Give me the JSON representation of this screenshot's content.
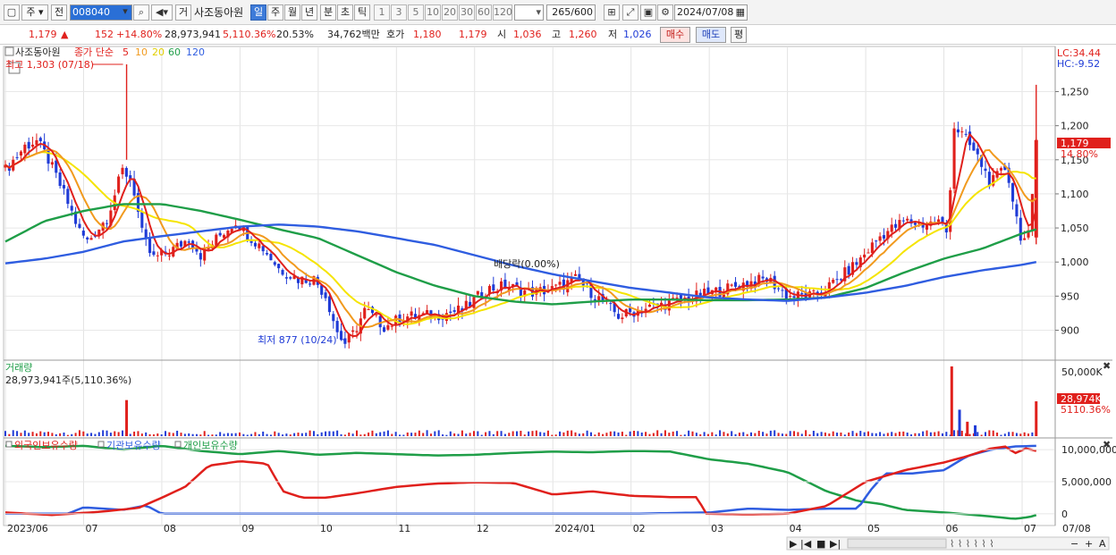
{
  "toolbar": {
    "market_label": "주",
    "prev_label": "전",
    "code": "008040",
    "gear_label": "거",
    "stock_name": "사조동아원",
    "periods": [
      "일",
      "주",
      "월",
      "년",
      "분",
      "초",
      "틱"
    ],
    "active_period": "일",
    "period_numbers": [
      "1",
      "3",
      "5",
      "10",
      "20",
      "30",
      "60",
      "120"
    ],
    "count": "265",
    "count_max": "/600",
    "date": "2024/07/08"
  },
  "quote": {
    "price": "1,179",
    "change_arrow": "▲",
    "change": "152",
    "change_pct": "+14.80%",
    "volume": "28,973,941",
    "volume_pct": "5,110.36%",
    "turnover": "20.53%",
    "amount": "34,762백만",
    "bid_label": "호가",
    "ask": "1,180",
    "bid": "1,179",
    "open_label": "시",
    "open": "1,036",
    "high_label": "고",
    "high": "1,260",
    "low_label": "저",
    "low": "1,026",
    "buy_label": "매수",
    "sell_label": "매도",
    "extra_label": "평"
  },
  "colors": {
    "up": "#e0201c",
    "down": "#1f3bd6",
    "ma5": "#e0201c",
    "ma10": "#f19a1e",
    "ma20": "#f5e400",
    "ma60": "#1f9e48",
    "ma120": "#2f5de0",
    "foreign": "#e0201c",
    "institution": "#2f5de0",
    "individual": "#1f9e48"
  },
  "chart_data": [
    {
      "type": "candlestick",
      "title": "사조동아원",
      "legend": [
        "종가 단순",
        "5",
        "10",
        "20",
        "60",
        "120"
      ],
      "legend_position": "top-left",
      "ylim": [
        860,
        1290
      ],
      "y_ticks": [
        900,
        950,
        1000,
        1050,
        1100,
        1150,
        1200,
        1250
      ],
      "x_ticks": [
        "2023/06",
        "07",
        "08",
        "09",
        "10",
        "11",
        "12",
        "2024/01",
        "02",
        "03",
        "04",
        "05",
        "06",
        "07"
      ],
      "lc": "LC:34.44",
      "hc": "HC:-9.52",
      "last_price_tag": "1,179",
      "last_change_tag": "14.80%",
      "annotations": {
        "high": "최고 1,303 (07/18)",
        "low": "최저 877 (10/24)",
        "dividend": "배당락(0.00%)"
      },
      "close_keypoints": [
        {
          "m": 0.0,
          "v": 1135
        },
        {
          "m": 0.25,
          "v": 1170
        },
        {
          "m": 0.4,
          "v": 1178
        },
        {
          "m": 0.55,
          "v": 1150
        },
        {
          "m": 0.75,
          "v": 1100
        },
        {
          "m": 0.95,
          "v": 1045
        },
        {
          "m": 1.05,
          "v": 1030
        },
        {
          "m": 1.3,
          "v": 1065
        },
        {
          "m": 1.5,
          "v": 1135
        },
        {
          "m": 1.62,
          "v": 1120
        },
        {
          "m": 1.75,
          "v": 1040
        },
        {
          "m": 1.88,
          "v": 1005
        },
        {
          "m": 2.1,
          "v": 1015
        },
        {
          "m": 2.35,
          "v": 1035
        },
        {
          "m": 2.5,
          "v": 1010
        },
        {
          "m": 2.75,
          "v": 1040
        },
        {
          "m": 2.95,
          "v": 1060
        },
        {
          "m": 3.1,
          "v": 1040
        },
        {
          "m": 3.3,
          "v": 1020
        },
        {
          "m": 3.5,
          "v": 990
        },
        {
          "m": 3.75,
          "v": 975
        },
        {
          "m": 3.95,
          "v": 975
        },
        {
          "m": 4.1,
          "v": 950
        },
        {
          "m": 4.25,
          "v": 895
        },
        {
          "m": 4.35,
          "v": 880
        },
        {
          "m": 4.45,
          "v": 895
        },
        {
          "m": 4.6,
          "v": 930
        },
        {
          "m": 4.85,
          "v": 905
        },
        {
          "m": 5.1,
          "v": 920
        },
        {
          "m": 5.5,
          "v": 922
        },
        {
          "m": 5.85,
          "v": 930
        },
        {
          "m": 6.15,
          "v": 960
        },
        {
          "m": 6.4,
          "v": 965
        },
        {
          "m": 6.7,
          "v": 955
        },
        {
          "m": 7.0,
          "v": 960
        },
        {
          "m": 7.3,
          "v": 975
        },
        {
          "m": 7.55,
          "v": 950
        },
        {
          "m": 7.85,
          "v": 920
        },
        {
          "m": 8.1,
          "v": 930
        },
        {
          "m": 8.5,
          "v": 940
        },
        {
          "m": 8.85,
          "v": 950
        },
        {
          "m": 9.2,
          "v": 960
        },
        {
          "m": 9.5,
          "v": 970
        },
        {
          "m": 9.75,
          "v": 975
        },
        {
          "m": 10.0,
          "v": 950
        },
        {
          "m": 10.35,
          "v": 950
        },
        {
          "m": 10.6,
          "v": 970
        },
        {
          "m": 10.9,
          "v": 1000
        },
        {
          "m": 11.2,
          "v": 1040
        },
        {
          "m": 11.5,
          "v": 1060
        },
        {
          "m": 11.75,
          "v": 1055
        },
        {
          "m": 11.95,
          "v": 1060
        },
        {
          "m": 12.05,
          "v": 1040
        },
        {
          "m": 12.12,
          "v": 1200
        },
        {
          "m": 12.25,
          "v": 1185
        },
        {
          "m": 12.45,
          "v": 1150
        },
        {
          "m": 12.6,
          "v": 1115
        },
        {
          "m": 12.8,
          "v": 1140
        },
        {
          "m": 12.9,
          "v": 1080
        },
        {
          "m": 13.0,
          "v": 1030
        },
        {
          "m": 13.1,
          "v": 1040
        },
        {
          "m": 13.18,
          "v": 1179
        }
      ],
      "ma60_keypoints": [
        {
          "m": 0.0,
          "v": 1030
        },
        {
          "m": 0.5,
          "v": 1060
        },
        {
          "m": 1.0,
          "v": 1075
        },
        {
          "m": 1.5,
          "v": 1085
        },
        {
          "m": 2.0,
          "v": 1085
        },
        {
          "m": 2.5,
          "v": 1075
        },
        {
          "m": 3.0,
          "v": 1062
        },
        {
          "m": 3.5,
          "v": 1048
        },
        {
          "m": 4.0,
          "v": 1035
        },
        {
          "m": 4.5,
          "v": 1010
        },
        {
          "m": 5.0,
          "v": 985
        },
        {
          "m": 5.5,
          "v": 965
        },
        {
          "m": 6.0,
          "v": 950
        },
        {
          "m": 6.5,
          "v": 942
        },
        {
          "m": 7.0,
          "v": 938
        },
        {
          "m": 7.5,
          "v": 942
        },
        {
          "m": 8.0,
          "v": 945
        },
        {
          "m": 8.5,
          "v": 945
        },
        {
          "m": 9.0,
          "v": 944
        },
        {
          "m": 9.5,
          "v": 944
        },
        {
          "m": 10.0,
          "v": 945
        },
        {
          "m": 10.5,
          "v": 948
        },
        {
          "m": 11.0,
          "v": 962
        },
        {
          "m": 11.5,
          "v": 985
        },
        {
          "m": 12.0,
          "v": 1005
        },
        {
          "m": 12.5,
          "v": 1020
        },
        {
          "m": 13.0,
          "v": 1042
        },
        {
          "m": 13.18,
          "v": 1048
        }
      ],
      "ma120_keypoints": [
        {
          "m": 0.0,
          "v": 998
        },
        {
          "m": 0.5,
          "v": 1005
        },
        {
          "m": 1.0,
          "v": 1015
        },
        {
          "m": 1.5,
          "v": 1030
        },
        {
          "m": 2.0,
          "v": 1038
        },
        {
          "m": 2.5,
          "v": 1045
        },
        {
          "m": 3.0,
          "v": 1052
        },
        {
          "m": 3.5,
          "v": 1055
        },
        {
          "m": 4.0,
          "v": 1052
        },
        {
          "m": 4.5,
          "v": 1045
        },
        {
          "m": 5.0,
          "v": 1035
        },
        {
          "m": 5.5,
          "v": 1025
        },
        {
          "m": 6.0,
          "v": 1010
        },
        {
          "m": 6.5,
          "v": 995
        },
        {
          "m": 7.0,
          "v": 982
        },
        {
          "m": 7.5,
          "v": 972
        },
        {
          "m": 8.0,
          "v": 962
        },
        {
          "m": 8.5,
          "v": 955
        },
        {
          "m": 9.0,
          "v": 948
        },
        {
          "m": 9.5,
          "v": 945
        },
        {
          "m": 10.0,
          "v": 943
        },
        {
          "m": 10.5,
          "v": 948
        },
        {
          "m": 11.0,
          "v": 955
        },
        {
          "m": 11.5,
          "v": 965
        },
        {
          "m": 12.0,
          "v": 978
        },
        {
          "m": 12.5,
          "v": 988
        },
        {
          "m": 13.0,
          "v": 996
        },
        {
          "m": 13.18,
          "v": 1000
        }
      ]
    },
    {
      "type": "bar",
      "title": "거래량",
      "summary": "28,973,941주(5,110.36%)",
      "y_ticks": [
        "50,000K"
      ],
      "ylim": [
        0,
        58000
      ],
      "last_value_tag": "28,974K",
      "last_pct_tag": "5110.36%",
      "spikes": [
        {
          "m": 1.55,
          "v": 30000,
          "color": "up"
        },
        {
          "m": 12.1,
          "v": 58000,
          "color": "up"
        },
        {
          "m": 12.2,
          "v": 22000,
          "color": "down"
        },
        {
          "m": 12.3,
          "v": 12000,
          "color": "up"
        },
        {
          "m": 12.4,
          "v": 9000,
          "color": "down"
        },
        {
          "m": 13.18,
          "v": 28974,
          "color": "up"
        }
      ],
      "baseline": 2500
    },
    {
      "type": "line",
      "legend": [
        "외국인보유수량",
        "기관보유수량",
        "개인보유수량"
      ],
      "legend_position": "top-left",
      "ylim": [
        -1000000,
        11000000
      ],
      "y_ticks": [
        {
          "v": 0,
          "label": "0"
        },
        {
          "v": 5000000,
          "label": "5,000,000"
        },
        {
          "v": 10000000,
          "label": "10,000,000"
        }
      ],
      "last_x_tag": "07/08",
      "series": [
        {
          "name": "외국인보유수량",
          "color": "foreign",
          "points": [
            {
              "m": 0.0,
              "v": 200000
            },
            {
              "m": 0.6,
              "v": -200000
            },
            {
              "m": 1.2,
              "v": 300000
            },
            {
              "m": 1.7,
              "v": 900000
            },
            {
              "m": 2.0,
              "v": 2500000
            },
            {
              "m": 2.3,
              "v": 4200000
            },
            {
              "m": 2.6,
              "v": 7500000
            },
            {
              "m": 3.0,
              "v": 8200000
            },
            {
              "m": 3.35,
              "v": 7800000
            },
            {
              "m": 3.55,
              "v": 3500000
            },
            {
              "m": 3.8,
              "v": 2500000
            },
            {
              "m": 4.1,
              "v": 2500000
            },
            {
              "m": 4.5,
              "v": 3200000
            },
            {
              "m": 5.0,
              "v": 4200000
            },
            {
              "m": 5.5,
              "v": 4700000
            },
            {
              "m": 6.0,
              "v": 4900000
            },
            {
              "m": 6.5,
              "v": 4800000
            },
            {
              "m": 7.0,
              "v": 3000000
            },
            {
              "m": 7.5,
              "v": 3500000
            },
            {
              "m": 8.0,
              "v": 2800000
            },
            {
              "m": 8.5,
              "v": 2600000
            },
            {
              "m": 8.85,
              "v": 2600000
            },
            {
              "m": 8.95,
              "v": 0
            },
            {
              "m": 9.5,
              "v": -100000
            },
            {
              "m": 10.0,
              "v": 0
            },
            {
              "m": 10.5,
              "v": 1200000
            },
            {
              "m": 11.0,
              "v": 5000000
            },
            {
              "m": 11.5,
              "v": 6800000
            },
            {
              "m": 12.0,
              "v": 8000000
            },
            {
              "m": 12.3,
              "v": 9000000
            },
            {
              "m": 12.6,
              "v": 10200000
            },
            {
              "m": 12.8,
              "v": 10500000
            },
            {
              "m": 12.9,
              "v": 9400000
            },
            {
              "m": 13.05,
              "v": 10200000
            },
            {
              "m": 13.18,
              "v": 9800000
            }
          ]
        },
        {
          "name": "기관보유수량",
          "color": "institution",
          "points": [
            {
              "m": 0.0,
              "v": 0
            },
            {
              "m": 0.8,
              "v": 0
            },
            {
              "m": 1.0,
              "v": 1000000
            },
            {
              "m": 1.5,
              "v": 600000
            },
            {
              "m": 1.8,
              "v": 1300000
            },
            {
              "m": 2.0,
              "v": 0
            },
            {
              "m": 3.0,
              "v": 0
            },
            {
              "m": 4.0,
              "v": 0
            },
            {
              "m": 5.0,
              "v": 0
            },
            {
              "m": 6.0,
              "v": 0
            },
            {
              "m": 7.0,
              "v": 0
            },
            {
              "m": 8.0,
              "v": 0
            },
            {
              "m": 9.0,
              "v": 200000
            },
            {
              "m": 9.5,
              "v": 800000
            },
            {
              "m": 10.0,
              "v": 600000
            },
            {
              "m": 10.5,
              "v": 800000
            },
            {
              "m": 10.9,
              "v": 800000
            },
            {
              "m": 11.05,
              "v": 3500000
            },
            {
              "m": 11.25,
              "v": 6300000
            },
            {
              "m": 11.6,
              "v": 6300000
            },
            {
              "m": 12.0,
              "v": 6800000
            },
            {
              "m": 12.3,
              "v": 9000000
            },
            {
              "m": 12.6,
              "v": 10000000
            },
            {
              "m": 12.9,
              "v": 10500000
            },
            {
              "m": 13.18,
              "v": 10600000
            }
          ]
        },
        {
          "name": "개인보유수량",
          "color": "individual",
          "points": [
            {
              "m": 0.0,
              "v": 10600000
            },
            {
              "m": 0.5,
              "v": 10400000
            },
            {
              "m": 1.0,
              "v": 10600000
            },
            {
              "m": 1.5,
              "v": 10000000
            },
            {
              "m": 2.0,
              "v": 10600000
            },
            {
              "m": 2.5,
              "v": 9800000
            },
            {
              "m": 3.0,
              "v": 9300000
            },
            {
              "m": 3.5,
              "v": 9800000
            },
            {
              "m": 4.0,
              "v": 9200000
            },
            {
              "m": 4.5,
              "v": 9500000
            },
            {
              "m": 5.0,
              "v": 9300000
            },
            {
              "m": 5.5,
              "v": 9100000
            },
            {
              "m": 6.0,
              "v": 9200000
            },
            {
              "m": 6.5,
              "v": 9500000
            },
            {
              "m": 7.0,
              "v": 9700000
            },
            {
              "m": 7.5,
              "v": 9600000
            },
            {
              "m": 8.0,
              "v": 9800000
            },
            {
              "m": 8.5,
              "v": 9700000
            },
            {
              "m": 9.0,
              "v": 8500000
            },
            {
              "m": 9.5,
              "v": 7800000
            },
            {
              "m": 10.0,
              "v": 6500000
            },
            {
              "m": 10.5,
              "v": 3500000
            },
            {
              "m": 10.9,
              "v": 2000000
            },
            {
              "m": 11.2,
              "v": 1500000
            },
            {
              "m": 11.5,
              "v": 600000
            },
            {
              "m": 12.0,
              "v": 200000
            },
            {
              "m": 12.5,
              "v": -300000
            },
            {
              "m": 12.9,
              "v": -800000
            },
            {
              "m": 13.1,
              "v": -500000
            },
            {
              "m": 13.18,
              "v": -200000
            }
          ]
        }
      ]
    }
  ],
  "bottom_nav": {
    "first": "▶",
    "buttons": [
      "|◀",
      "■",
      "▶|"
    ],
    "zoom": [
      "−",
      "+",
      "A"
    ]
  }
}
